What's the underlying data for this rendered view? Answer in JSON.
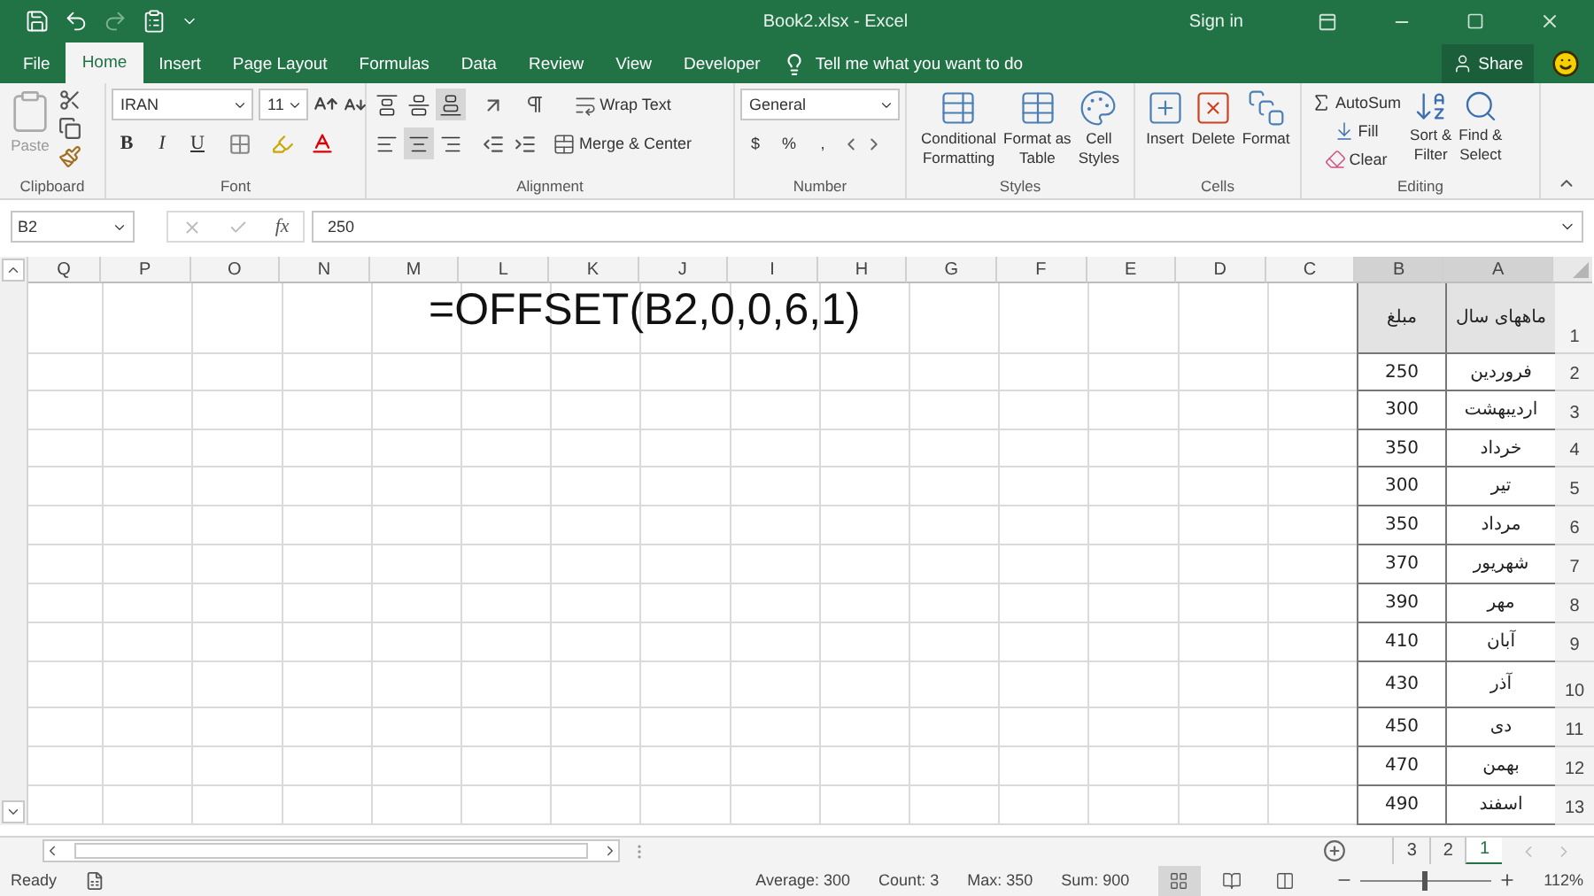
{
  "window": {
    "title": "Book2.xlsx - Excel",
    "sign_in": "Sign in"
  },
  "ribbon_tabs": [
    {
      "label": "File",
      "selected": false
    },
    {
      "label": "Home",
      "selected": true
    },
    {
      "label": "Insert",
      "selected": false
    },
    {
      "label": "Page Layout",
      "selected": false
    },
    {
      "label": "Formulas",
      "selected": false
    },
    {
      "label": "Data",
      "selected": false
    },
    {
      "label": "Review",
      "selected": false
    },
    {
      "label": "View",
      "selected": false
    },
    {
      "label": "Developer",
      "selected": false
    }
  ],
  "tell_me": {
    "placeholder": "Tell me what you want to do"
  },
  "share": "Share",
  "clipboard": {
    "label": "Clipboard",
    "paste": "Paste"
  },
  "font": {
    "label": "Font",
    "name": "IRAN",
    "size": "11",
    "styles": [
      "B",
      "I",
      "U"
    ]
  },
  "alignment": {
    "label": "Alignment",
    "wrap_text": "Wrap Text",
    "merge": "Merge & Center",
    "vertical": [
      {
        "kind": "top",
        "selected": false
      },
      {
        "kind": "middle",
        "selected": false
      },
      {
        "kind": "bottom",
        "selected": true
      }
    ],
    "horizontal": [
      {
        "kind": "left",
        "selected": false
      },
      {
        "kind": "center",
        "selected": true
      },
      {
        "kind": "right",
        "selected": false
      }
    ]
  },
  "number": {
    "label": "Number",
    "format": "General",
    "symbols": [
      "$",
      "%",
      ","
    ]
  },
  "styles": {
    "label": "Styles",
    "buttons": [
      {
        "kind": "conditional",
        "lines": [
          "Conditional",
          "Formatting"
        ]
      },
      {
        "kind": "table",
        "lines": [
          "Format as",
          "Table"
        ]
      },
      {
        "kind": "cell",
        "lines": [
          "Cell",
          "Styles"
        ]
      }
    ]
  },
  "cells": {
    "label": "Cells",
    "buttons": [
      {
        "kind": "insert",
        "label": "Insert"
      },
      {
        "kind": "delete",
        "label": "Delete"
      },
      {
        "kind": "format",
        "label": "Format"
      }
    ]
  },
  "editing": {
    "label": "Editing",
    "autosum": "AutoSum",
    "fill": "Fill",
    "clear": "Clear",
    "buttons": [
      {
        "kind": "sort",
        "lines": [
          "Sort &",
          "Filter"
        ]
      },
      {
        "kind": "find",
        "lines": [
          "Find &",
          "Select"
        ]
      }
    ]
  },
  "formula_bar": {
    "name_box": "B2",
    "function_symbol": "fx",
    "formula": "250"
  },
  "sheet": {
    "textbox": "=OFFSET(B2,0,0,6,1)",
    "columns": [
      {
        "label": "Q",
        "selected": false
      },
      {
        "label": "P",
        "selected": false
      },
      {
        "label": "O",
        "selected": false
      },
      {
        "label": "N",
        "selected": false
      },
      {
        "label": "M",
        "selected": false
      },
      {
        "label": "L",
        "selected": false
      },
      {
        "label": "K",
        "selected": false
      },
      {
        "label": "J",
        "selected": false
      },
      {
        "label": "I",
        "selected": false
      },
      {
        "label": "H",
        "selected": false
      },
      {
        "label": "G",
        "selected": false
      },
      {
        "label": "F",
        "selected": false
      },
      {
        "label": "E",
        "selected": false
      },
      {
        "label": "D",
        "selected": false
      },
      {
        "label": "C",
        "selected": false
      },
      {
        "label": "B",
        "selected": true
      },
      {
        "label": "A",
        "selected": true
      }
    ],
    "rows": [
      {
        "kind": "header",
        "amount": "مبلغ",
        "month": "ماههای سال",
        "number": "1"
      },
      {
        "kind": "data",
        "amount": "250",
        "month": "فروردین",
        "number": "2"
      },
      {
        "kind": "data",
        "amount": "300",
        "month": "اردیبهشت",
        "number": "3"
      },
      {
        "kind": "data",
        "amount": "350",
        "month": "خرداد",
        "number": "4"
      },
      {
        "kind": "data",
        "amount": "300",
        "month": "تیر",
        "number": "5"
      },
      {
        "kind": "data",
        "amount": "350",
        "month": "مرداد",
        "number": "6"
      },
      {
        "kind": "data",
        "amount": "370",
        "month": "شهریور",
        "number": "7"
      },
      {
        "kind": "data",
        "amount": "390",
        "month": "مهر",
        "number": "8"
      },
      {
        "kind": "data",
        "amount": "410",
        "month": "آبان",
        "number": "9"
      },
      {
        "kind": "data",
        "amount": "430",
        "month": "آذر",
        "number": "10"
      },
      {
        "kind": "data",
        "amount": "450",
        "month": "دی",
        "number": "11"
      },
      {
        "kind": "data",
        "amount": "470",
        "month": "بهمن",
        "number": "12"
      },
      {
        "kind": "data",
        "amount": "490",
        "month": "اسفند",
        "number": "13"
      }
    ]
  },
  "sheet_tabs": [
    {
      "label": "3",
      "selected": false
    },
    {
      "label": "2",
      "selected": false
    },
    {
      "label": "1",
      "selected": true
    }
  ],
  "status_bar": {
    "mode": "Ready",
    "stats": [
      "Average: 300",
      "Count: 3",
      "Max: 350",
      "Sum: 900"
    ],
    "views": [
      {
        "kind": "normal",
        "selected": true
      },
      {
        "kind": "page_layout",
        "selected": false
      },
      {
        "kind": "page_break",
        "selected": false
      }
    ],
    "zoom": {
      "level": 0.5,
      "reading": "112%"
    }
  }
}
